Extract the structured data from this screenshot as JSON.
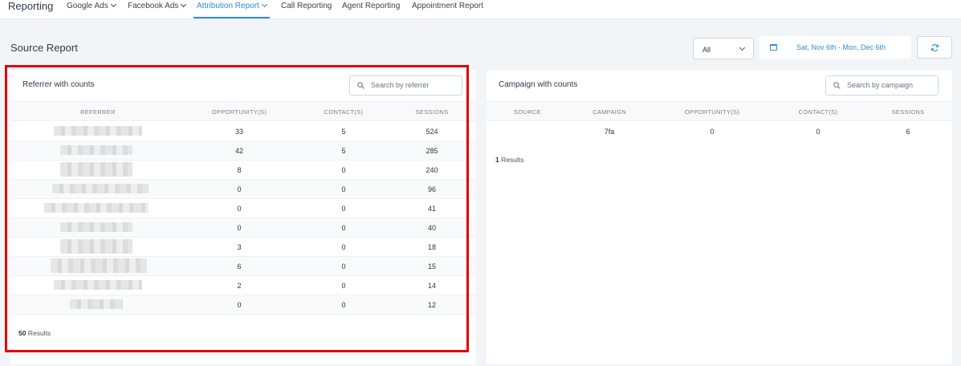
{
  "nav": {
    "brand": "Reporting",
    "items": [
      {
        "label": "Google Ads",
        "dropdown": true,
        "active": false
      },
      {
        "label": "Facebook Ads",
        "dropdown": true,
        "active": false
      },
      {
        "label": "Attribution Report",
        "dropdown": true,
        "active": true
      },
      {
        "label": "Call Reporting",
        "dropdown": false,
        "active": false
      },
      {
        "label": "Agent Reporting",
        "dropdown": false,
        "active": false
      },
      {
        "label": "Appointment Report",
        "dropdown": false,
        "active": false
      }
    ]
  },
  "page": {
    "title": "Source Report",
    "filter_value": "All",
    "date_range": "Sat, Nov 6th - Mon, Dec 6th"
  },
  "referrer": {
    "title": "Referrer with counts",
    "search_placeholder": "Search by referrer",
    "columns": [
      "REFERRER",
      "OPPORTUNITY(S)",
      "CONTACT(S)",
      "SESSIONS"
    ],
    "rows": [
      {
        "opportunities": "33",
        "contacts": "5",
        "sessions": "524"
      },
      {
        "opportunities": "42",
        "contacts": "5",
        "sessions": "285"
      },
      {
        "opportunities": "8",
        "contacts": "0",
        "sessions": "240"
      },
      {
        "opportunities": "0",
        "contacts": "0",
        "sessions": "96"
      },
      {
        "opportunities": "0",
        "contacts": "0",
        "sessions": "41"
      },
      {
        "opportunities": "0",
        "contacts": "0",
        "sessions": "40"
      },
      {
        "opportunities": "3",
        "contacts": "0",
        "sessions": "18"
      },
      {
        "opportunities": "6",
        "contacts": "0",
        "sessions": "15"
      },
      {
        "opportunities": "2",
        "contacts": "0",
        "sessions": "14"
      },
      {
        "opportunities": "0",
        "contacts": "0",
        "sessions": "12"
      }
    ],
    "results_count": "50",
    "results_label": "Results"
  },
  "campaign": {
    "title": "Campaign with counts",
    "search_placeholder": "Search by campaign",
    "columns": [
      "SOURCE",
      "CAMPAIGN",
      "OPPORTUNITY(S)",
      "CONTACT(S)",
      "SESSIONS"
    ],
    "rows": [
      {
        "source": "",
        "campaign": "7fa",
        "opportunities": "0",
        "contacts": "0",
        "sessions": "6"
      }
    ],
    "results_count": "1",
    "results_label": "Results"
  },
  "colors": {
    "accent": "#2f8ad6",
    "highlight": "#e00000",
    "background": "#f2f5f8"
  }
}
